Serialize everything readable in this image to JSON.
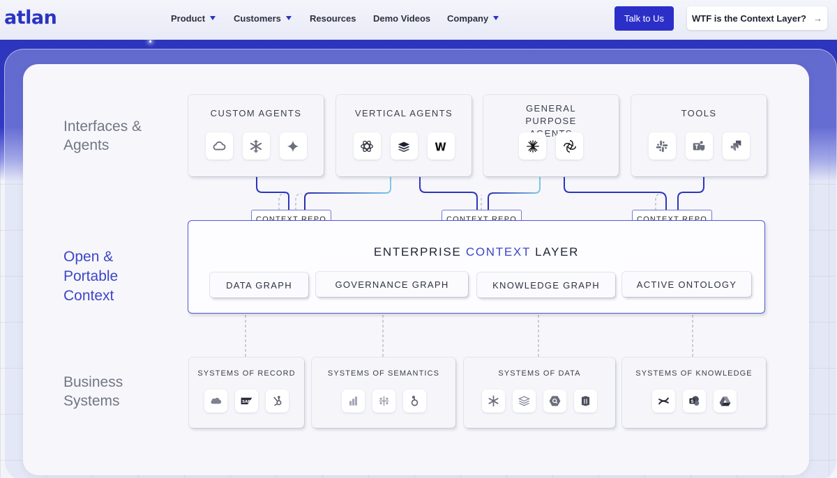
{
  "nav": {
    "logo": "atlan",
    "items": [
      {
        "label": "Product",
        "dropdown": true
      },
      {
        "label": "Customers",
        "dropdown": true
      },
      {
        "label": "Resources",
        "dropdown": false
      },
      {
        "label": "Demo Videos",
        "dropdown": false
      },
      {
        "label": "Company",
        "dropdown": true
      }
    ],
    "cta_primary": "Talk to Us",
    "cta_secondary": "WTF is the Context Layer?",
    "cta_secondary_arrow": "→",
    "colors": {
      "brand": "#2b33c2",
      "button": "#2b2fc7"
    }
  },
  "diagram": {
    "rows": {
      "interfaces": "Interfaces & Agents",
      "context": "Open & Portable Context",
      "business": "Business Systems"
    },
    "top_boxes": [
      {
        "title": "CUSTOM AGENTS",
        "icons": [
          "cloud-icon",
          "snowflake-icon",
          "sparkle-icon"
        ]
      },
      {
        "title": "VERTICAL AGENTS",
        "icons": [
          "atom-icon",
          "stack-icon",
          "w-logo-icon"
        ]
      },
      {
        "title": "GENERAL PURPOSE AGENTS",
        "icons": [
          "starburst-icon",
          "openai-icon"
        ]
      },
      {
        "title": "TOOLS",
        "icons": [
          "slack-icon",
          "teams-icon",
          "jira-icon"
        ]
      }
    ],
    "context_repo": [
      "CONTEXT REPO",
      "CONTEXT REPO",
      "CONTEXT REPO"
    ],
    "layer": {
      "title_pre": "ENTERPRISE ",
      "title_accent": "CONTEXT",
      "title_post": " LAYER",
      "graphs": [
        "DATA GRAPH",
        "GOVERNANCE GRAPH",
        "KNOWLEDGE GRAPH",
        "ACTIVE ONTOLOGY"
      ]
    },
    "bottom_boxes": [
      {
        "title": "SYSTEMS OF RECORD",
        "icons": [
          "salesforce-icon",
          "sap-icon",
          "hubspot-icon"
        ]
      },
      {
        "title": "SYSTEMS OF SEMANTICS",
        "icons": [
          "bar-chart-icon",
          "tableau-icon",
          "looker-icon"
        ]
      },
      {
        "title": "SYSTEMS OF DATA",
        "icons": [
          "snowflake-icon",
          "layers-icon",
          "bigquery-icon",
          "redshift-icon"
        ]
      },
      {
        "title": "SYSTEMS OF KNOWLEDGE",
        "icons": [
          "confluence-icon",
          "sharepoint-icon",
          "google-drive-icon"
        ]
      }
    ]
  }
}
